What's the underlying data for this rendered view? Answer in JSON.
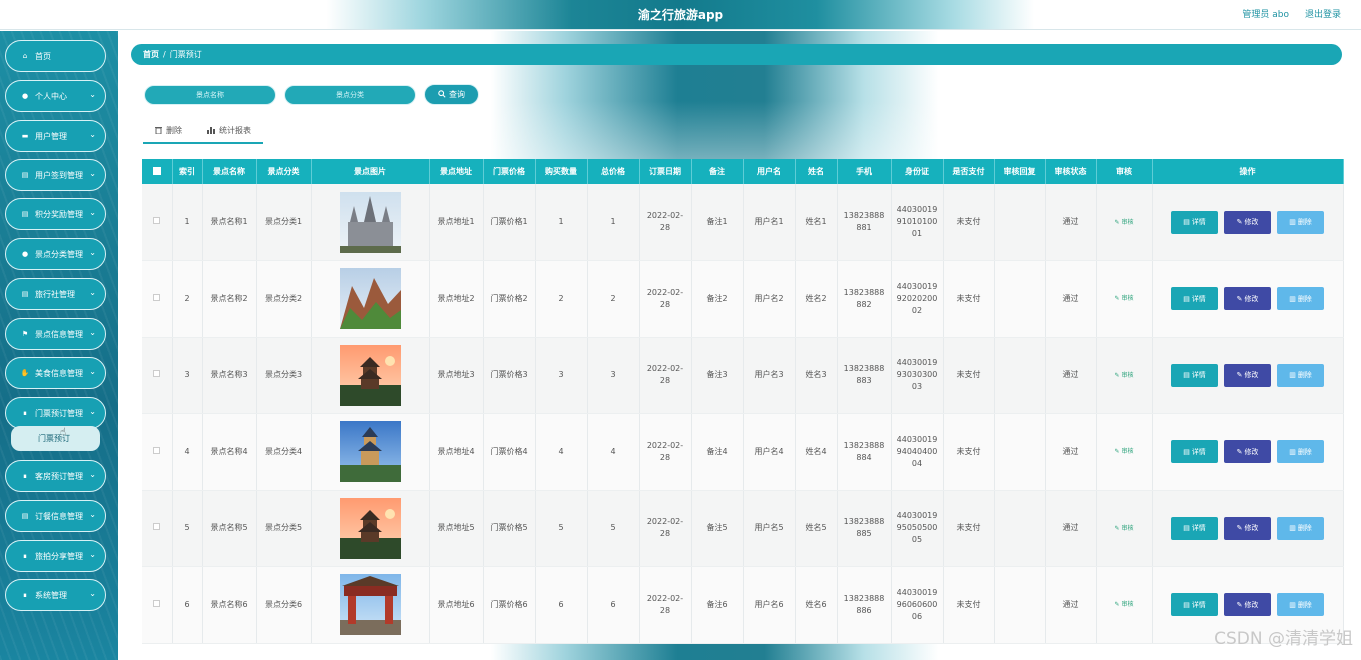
{
  "header": {
    "title": "渝之行旅游app",
    "admin_label": "管理员 abo",
    "logout_label": "退出登录"
  },
  "sidebar": {
    "items": [
      {
        "label": "首页",
        "icon": "home-icon",
        "has_chevron": false
      },
      {
        "label": "个人中心",
        "icon": "person-icon",
        "has_chevron": true
      },
      {
        "label": "用户管理",
        "icon": "monitor-icon",
        "has_chevron": true
      },
      {
        "label": "用户签到管理",
        "icon": "document-icon",
        "has_chevron": true
      },
      {
        "label": "积分奖励管理",
        "icon": "document-icon",
        "has_chevron": true
      },
      {
        "label": "景点分类管理",
        "icon": "person-icon",
        "has_chevron": true
      },
      {
        "label": "旅行社管理",
        "icon": "document-icon",
        "has_chevron": true
      },
      {
        "label": "景点信息管理",
        "icon": "flag-icon",
        "has_chevron": true
      },
      {
        "label": "美食信息管理",
        "icon": "thumb-icon",
        "has_chevron": true
      },
      {
        "label": "门票预订管理",
        "icon": "grid-icon",
        "has_chevron": true
      },
      {
        "label": "客房预订管理",
        "icon": "grid-icon",
        "has_chevron": true
      },
      {
        "label": "订餐信息管理",
        "icon": "document-icon",
        "has_chevron": true
      },
      {
        "label": "旅拍分享管理",
        "icon": "grid-icon",
        "has_chevron": true
      },
      {
        "label": "系统管理",
        "icon": "grid-icon",
        "has_chevron": true
      }
    ],
    "submenu_active": "门票预订"
  },
  "breadcrumb": {
    "home": "首页",
    "separator": "/",
    "current": "门票预订"
  },
  "search": {
    "name_placeholder": "景点名称",
    "category_placeholder": "景点分类",
    "button_label": "查询"
  },
  "tabs": {
    "delete_label": "删除",
    "stats_label": "统计报表"
  },
  "table": {
    "headers": [
      "",
      "索引",
      "景点名称",
      "景点分类",
      "景点图片",
      "景点地址",
      "门票价格",
      "购买数量",
      "总价格",
      "订票日期",
      "备注",
      "用户名",
      "姓名",
      "手机",
      "身份证",
      "是否支付",
      "审核回复",
      "审核状态",
      "审核",
      "操作"
    ],
    "audit_label": "审核",
    "detail_label": "详情",
    "edit_label": "修改",
    "delete_label": "删除",
    "rows": [
      {
        "index": "1",
        "name": "景点名称1",
        "category": "景点分类1",
        "address": "景点地址1",
        "price": "门票价格1",
        "qty": "1",
        "total": "1",
        "date1": "2022-02-",
        "date2": "28",
        "note": "备注1",
        "username": "用户名1",
        "realname": "姓名1",
        "phone1": "13823888",
        "phone2": "881",
        "id1": "44030019",
        "id2": "91010100",
        "id3": "01",
        "paid": "未支付",
        "reply": "",
        "status": "通过"
      },
      {
        "index": "2",
        "name": "景点名称2",
        "category": "景点分类2",
        "address": "景点地址2",
        "price": "门票价格2",
        "qty": "2",
        "total": "2",
        "date1": "2022-02-",
        "date2": "28",
        "note": "备注2",
        "username": "用户名2",
        "realname": "姓名2",
        "phone1": "13823888",
        "phone2": "882",
        "id1": "44030019",
        "id2": "92020200",
        "id3": "02",
        "paid": "未支付",
        "reply": "",
        "status": "通过"
      },
      {
        "index": "3",
        "name": "景点名称3",
        "category": "景点分类3",
        "address": "景点地址3",
        "price": "门票价格3",
        "qty": "3",
        "total": "3",
        "date1": "2022-02-",
        "date2": "28",
        "note": "备注3",
        "username": "用户名3",
        "realname": "姓名3",
        "phone1": "13823888",
        "phone2": "883",
        "id1": "44030019",
        "id2": "93030300",
        "id3": "03",
        "paid": "未支付",
        "reply": "",
        "status": "通过"
      },
      {
        "index": "4",
        "name": "景点名称4",
        "category": "景点分类4",
        "address": "景点地址4",
        "price": "门票价格4",
        "qty": "4",
        "total": "4",
        "date1": "2022-02-",
        "date2": "28",
        "note": "备注4",
        "username": "用户名4",
        "realname": "姓名4",
        "phone1": "13823888",
        "phone2": "884",
        "id1": "44030019",
        "id2": "94040400",
        "id3": "04",
        "paid": "未支付",
        "reply": "",
        "status": "通过"
      },
      {
        "index": "5",
        "name": "景点名称5",
        "category": "景点分类5",
        "address": "景点地址5",
        "price": "门票价格5",
        "qty": "5",
        "total": "5",
        "date1": "2022-02-",
        "date2": "28",
        "note": "备注5",
        "username": "用户名5",
        "realname": "姓名5",
        "phone1": "13823888",
        "phone2": "885",
        "id1": "44030019",
        "id2": "95050500",
        "id3": "05",
        "paid": "未支付",
        "reply": "",
        "status": "通过"
      },
      {
        "index": "6",
        "name": "景点名称6",
        "category": "景点分类6",
        "address": "景点地址6",
        "price": "门票价格6",
        "qty": "6",
        "total": "6",
        "date1": "2022-02-",
        "date2": "28",
        "note": "备注6",
        "username": "用户名6",
        "realname": "姓名6",
        "phone1": "13823888",
        "phone2": "886",
        "id1": "44030019",
        "id2": "96060600",
        "id3": "06",
        "paid": "未支付",
        "reply": "",
        "status": "通过"
      }
    ]
  },
  "watermark": "CSDN @清清学姐",
  "colors": {
    "accent": "#1aa6b5",
    "edit": "#3f4aa5",
    "delete": "#5fb8ea",
    "sidebar": "#17a0b3"
  }
}
